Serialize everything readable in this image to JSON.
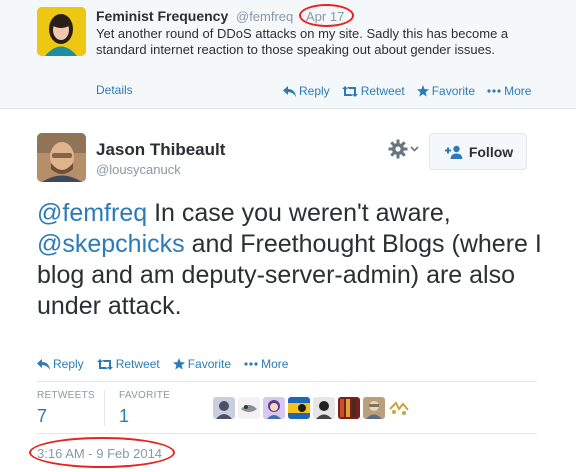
{
  "parent_tweet": {
    "author_name": "Feminist Frequency",
    "author_handle": "@femfreq",
    "date": "Apr 17",
    "text": "Yet another round of DDoS attacks on my site. Sadly this has become a standard internet reaction to those speaking out about gender issues.",
    "details_label": "Details",
    "actions": {
      "reply": "Reply",
      "retweet": "Retweet",
      "favorite": "Favorite",
      "more": "More"
    }
  },
  "tweet": {
    "author_name": "Jason Thibeault",
    "author_handle": "@lousycanuck",
    "follow_label": "Follow",
    "text_parts": {
      "mention1": "@femfreq",
      "seg1": " In case you weren't aware, ",
      "mention2": "@skepchicks",
      "seg2": " and Freethought Blogs (where I blog and am deputy-server-admin) are also under attack."
    },
    "actions": {
      "reply": "Reply",
      "retweet": "Retweet",
      "favorite": "Favorite",
      "more": "More"
    },
    "stats": {
      "retweets_label": "RETWEETS",
      "retweets_value": "7",
      "favorites_label": "FAVORITE",
      "favorites_value": "1"
    },
    "timestamp": "3:16 AM - 9 Feb 2014"
  },
  "icons": [
    "reply-icon",
    "retweet-icon",
    "favorite-icon",
    "more-icon",
    "gear-icon",
    "follow-icon"
  ],
  "colors": {
    "link": "#2b7bb9",
    "muted": "#8899a6",
    "text": "#292f33",
    "highlight_circle": "#e8221c"
  }
}
